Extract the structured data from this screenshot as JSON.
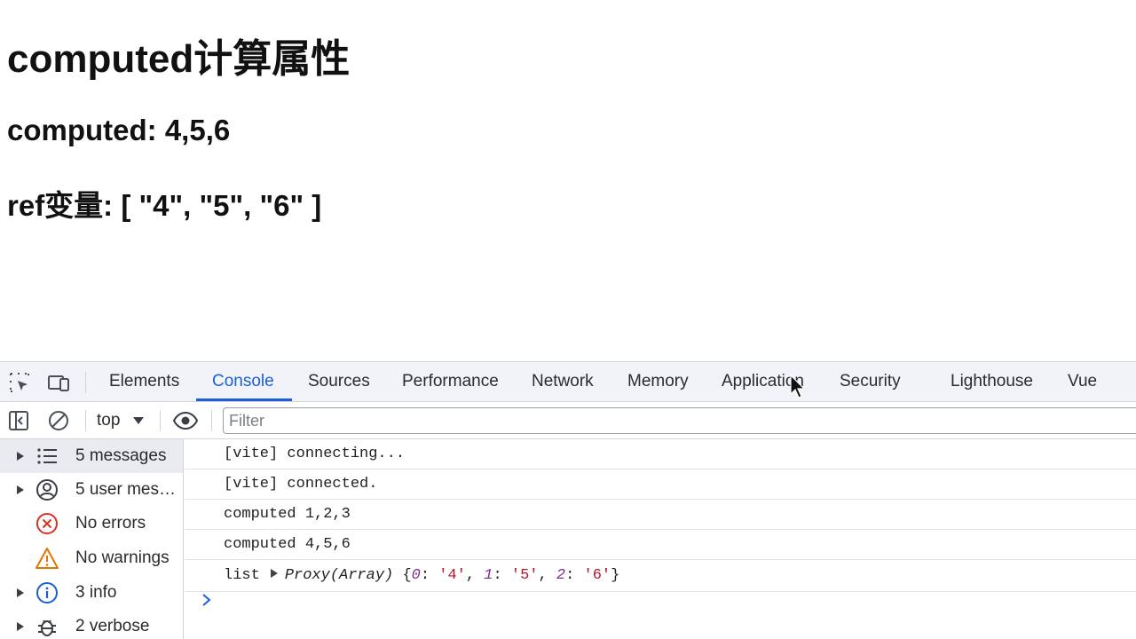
{
  "page": {
    "title": "computed计算属性",
    "computed_line": "computed: 4,5,6",
    "ref_line": "ref变量: [ \"4\", \"5\", \"6\" ]"
  },
  "devtools": {
    "tabs": [
      {
        "label": "Elements"
      },
      {
        "label": "Console"
      },
      {
        "label": "Sources"
      },
      {
        "label": "Performance"
      },
      {
        "label": "Network"
      },
      {
        "label": "Memory"
      },
      {
        "label": "Application"
      },
      {
        "label": "Security"
      },
      {
        "label": "Lighthouse"
      },
      {
        "label": "Vue"
      }
    ],
    "active_tab": "Console",
    "accent": "#1a5fd8",
    "toolbar": {
      "context": "top",
      "filter_placeholder": "Filter"
    },
    "sidebar": {
      "items": [
        {
          "label": "5 messages",
          "icon": "list-icon"
        },
        {
          "label": "5 user mes…",
          "icon": "user-icon"
        },
        {
          "label": "No errors",
          "icon": "error-icon"
        },
        {
          "label": "No warnings",
          "icon": "warning-icon"
        },
        {
          "label": "3 info",
          "icon": "info-icon"
        },
        {
          "label": "2 verbose",
          "icon": "bug-icon"
        }
      ]
    },
    "messages": [
      "[vite] connecting...",
      "[vite] connected.",
      "computed 1,2,3",
      "computed 4,5,6"
    ],
    "list_message": {
      "label": "list",
      "type": "Proxy(Array)",
      "open": "{",
      "entries": [
        {
          "key": "0",
          "value": "'4'"
        },
        {
          "key": "1",
          "value": "'5'"
        },
        {
          "key": "2",
          "value": "'6'"
        }
      ],
      "close": "}"
    }
  }
}
